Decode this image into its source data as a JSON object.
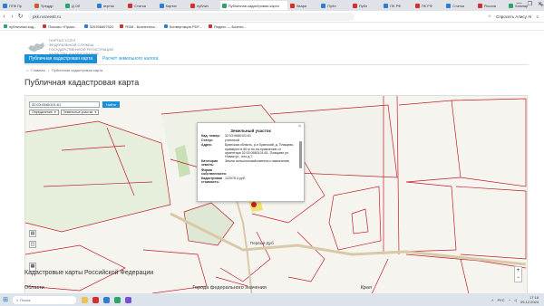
{
  "browser": {
    "tabs": [
      {
        "label": "ППК Пр",
        "color": "#2f7cd3"
      },
      {
        "label": "Преддр",
        "color": "#d35a2f"
      },
      {
        "label": "Д Об",
        "color": "#2fa36a"
      },
      {
        "label": "вертик",
        "color": "#2f7cd3"
      },
      {
        "label": "Статья",
        "color": "#d32f2f"
      },
      {
        "label": "Картоп",
        "color": "#2f7cd3"
      },
      {
        "label": "публич",
        "color": "#d32f2f"
      },
      {
        "label": "Публичная кадастровая карта",
        "color": "#2fa36a",
        "active": true
      },
      {
        "label": "Хвари",
        "color": "#d32f2f"
      },
      {
        "label": "Публ",
        "color": "#2f7cd3"
      },
      {
        "label": "Публ",
        "color": "#d32f2f"
      },
      {
        "label": "ПК РФ",
        "color": "#2f7cd3"
      },
      {
        "label": "ПК РФ",
        "color": "#d32f2f"
      },
      {
        "label": "Статья",
        "color": "#2f7cd3"
      },
      {
        "label": "Россия",
        "color": "#d32f2f"
      },
      {
        "label": "Компар",
        "color": "#2fa36a"
      }
    ],
    "newtab": "+",
    "window_controls": [
      "—",
      "❐",
      "✕"
    ],
    "url": "pkk.rosreestr.ru",
    "ask_label": "Спросить Алису AI",
    "bookmarks": [
      {
        "label": "публичная кад...",
        "color": "#2fa36a"
      },
      {
        "label": "Письмо «Проко...",
        "color": "#d32f2f"
      },
      {
        "label": "320396697520",
        "color": "#2f7cd3"
      },
      {
        "label": "RSM - Бизнеспла...",
        "color": "#d32f2f"
      },
      {
        "label": "Конвертация PDF...",
        "color": "#2f7cd3"
      },
      {
        "label": "Яндекс — Бизнес...",
        "color": "#d32f2f"
      }
    ]
  },
  "site": {
    "logo_line1": "Портал услуг",
    "logo_line2": "федеральной службы",
    "logo_line3": "государственной регистрации",
    "logo_line4": "кадастра и картографии",
    "menu_active": "Публичная кадастровая карта",
    "menu_link": "Расчёт земельного налога",
    "crumb_home": "Главная",
    "crumb_current": "Публичная кадастровая карта",
    "title": "Публичная кадастровая карта"
  },
  "map": {
    "search_value": "32:03:0680101:61",
    "search_button": "Найти",
    "select_objects": "Опредаление",
    "select_type": "Земельные участки",
    "popup": {
      "title": "Земельный участок",
      "close": "×",
      "rows": [
        {
          "key": "Кад. номер:",
          "value": "32:03:0680101:61"
        },
        {
          "key": "Статус:",
          "value": "учтенный"
        },
        {
          "key": "Адрес:",
          "value": "Брянская область, р-н Брянский, д. Плащево, примерно в 65 м по на-правлению от ориентира 32:03:0680101:61, Плащево ул. Новая ул., пло д.7"
        },
        {
          "key": "Категория земель:",
          "value": "Земли сельскохозяйственного назначения"
        },
        {
          "key": "Форма собственности:",
          "value": "-"
        },
        {
          "key": "Кадастровая стоимость:",
          "value": "122076.4 руб."
        }
      ]
    },
    "village_label": "Первый Дуб",
    "zoom_in": "+",
    "zoom_out": "−",
    "tool_layers": "▤",
    "tool_basemap": "◫"
  },
  "below": {
    "heading": "Кадастровые карты Российской Федерации",
    "col1": "Области",
    "col2": "Города федерального значения",
    "col3": "Края"
  },
  "taskbar": {
    "search_placeholder": "Поиск",
    "lang": "РУС",
    "time": "17:18",
    "date": "09.12.2024"
  },
  "colors": {
    "accent": "#1a8fd6",
    "parcel_line": "#c21f2a",
    "field_green": "#d9ebcf",
    "highlight_yellow": "#f3e06a"
  }
}
